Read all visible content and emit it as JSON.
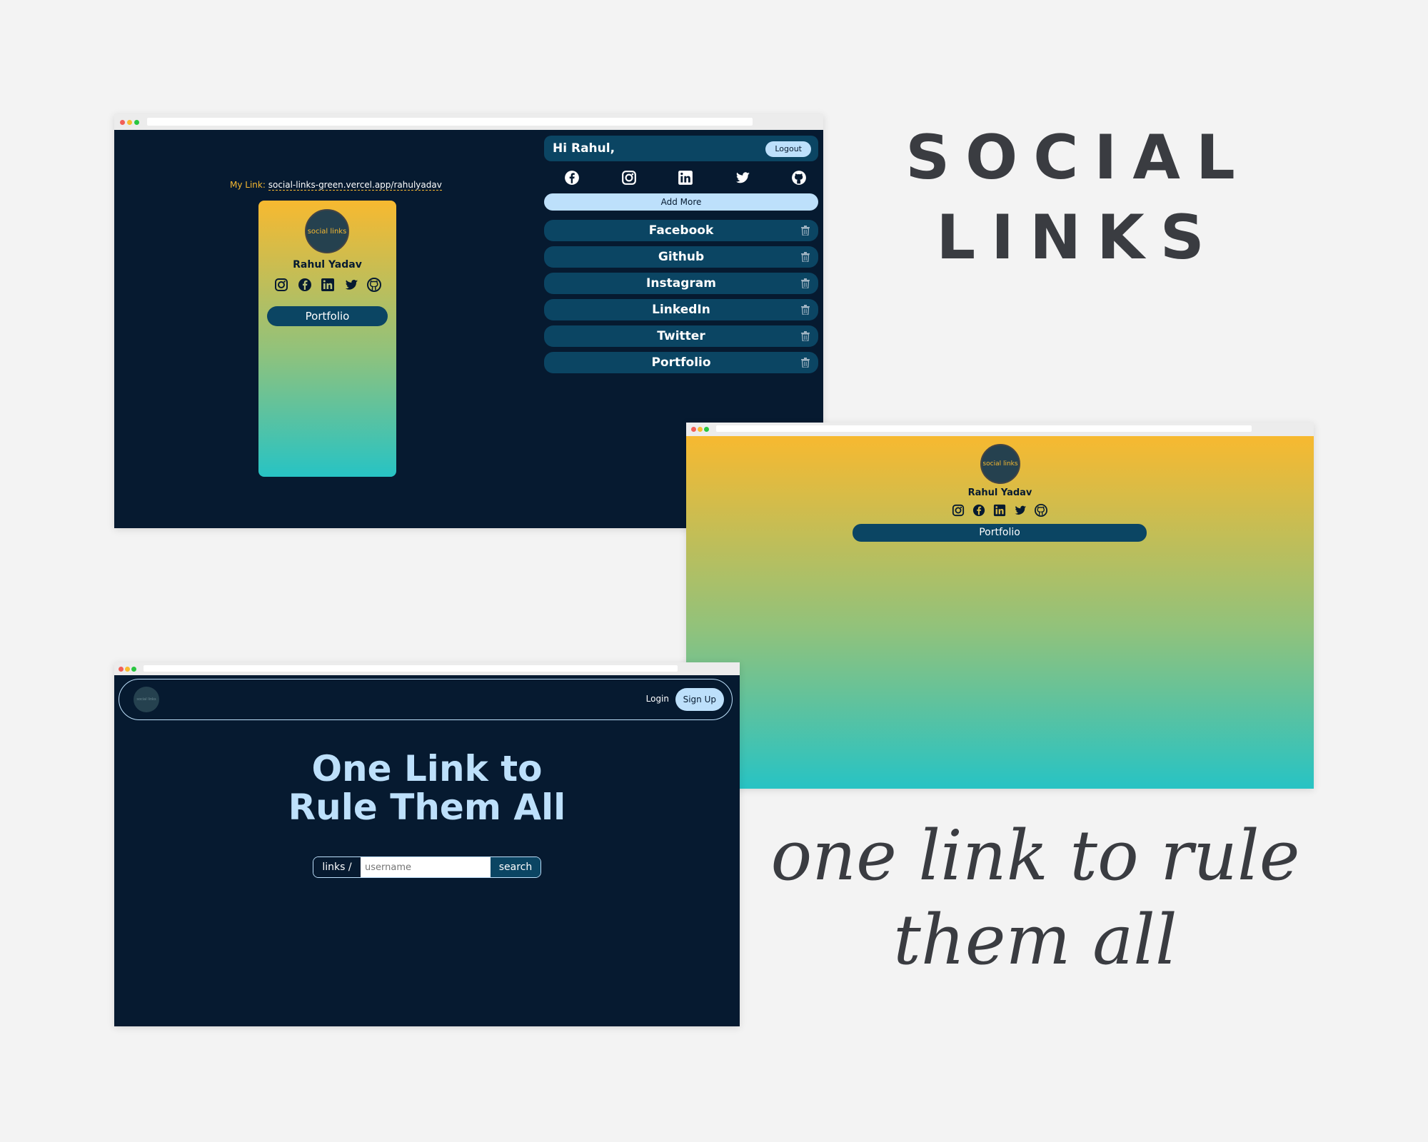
{
  "branding": {
    "title_line1": "SOCIAL",
    "title_line2": "LINKS",
    "tagline_line1": "one link to rule",
    "tagline_line2": "them all"
  },
  "colors": {
    "page_bg": "#f3f3f3",
    "navy": "#061a30",
    "teal_dark": "#0b4563",
    "light_blue": "#bde0fb",
    "gold": "#f7b930",
    "turquoise": "#27c3c4",
    "title_gray": "#3a3c41"
  },
  "dashboard": {
    "greeting": "Hi Rahul,",
    "logout_label": "Logout",
    "my_link_label": "My Link:",
    "my_link_url": "social-links-green.vercel.app/rahulyadav",
    "add_more_label": "Add More",
    "social_icons": [
      "facebook-icon",
      "instagram-icon",
      "linkedin-icon",
      "twitter-icon",
      "github-icon"
    ],
    "links": [
      {
        "label": "Facebook"
      },
      {
        "label": "Github"
      },
      {
        "label": "Instagram"
      },
      {
        "label": "LinkedIn"
      },
      {
        "label": "Twitter"
      },
      {
        "label": "Portfolio"
      }
    ],
    "preview": {
      "logo_text": "social links",
      "name": "Rahul Yadav",
      "icons": [
        "instagram-icon",
        "facebook-icon",
        "linkedin-icon",
        "twitter-icon",
        "github-icon"
      ],
      "button_label": "Portfolio"
    }
  },
  "profile_page": {
    "logo_text": "social links",
    "name": "Rahul Yadav",
    "icons": [
      "instagram-icon",
      "facebook-icon",
      "linkedin-icon",
      "twitter-icon",
      "github-icon"
    ],
    "button_label": "Portfolio"
  },
  "landing": {
    "logo_text": "social links",
    "login_label": "Login",
    "signup_label": "Sign Up",
    "hero_line1": "One Link to",
    "hero_line2": "Rule Them All",
    "search_prefix": "links /",
    "search_placeholder": "username",
    "search_button": "search"
  }
}
